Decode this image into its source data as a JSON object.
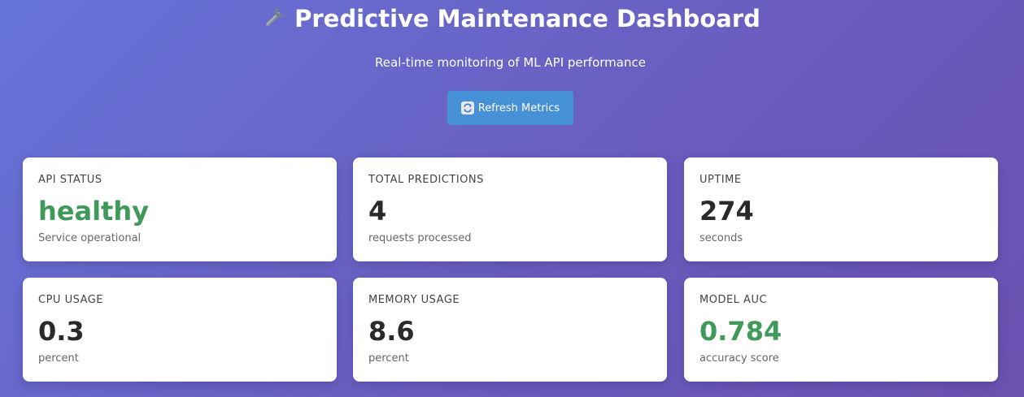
{
  "header": {
    "title": "Predictive Maintenance Dashboard",
    "title_icon": "wrench-icon",
    "subtitle": "Real-time monitoring of ML API performance"
  },
  "toolbar": {
    "refresh_label": "Refresh Metrics",
    "refresh_icon": "refresh-icon"
  },
  "colors": {
    "accent_button": "#4690d8",
    "good": "#3f9a5a",
    "value_default": "#2a2a2a"
  },
  "metrics": [
    {
      "label": "API STATUS",
      "value": "healthy",
      "sub": "Service operational",
      "status": "good"
    },
    {
      "label": "TOTAL PREDICTIONS",
      "value": "4",
      "sub": "requests processed",
      "status": "default"
    },
    {
      "label": "UPTIME",
      "value": "274",
      "sub": "seconds",
      "status": "default"
    },
    {
      "label": "CPU USAGE",
      "value": "0.3",
      "sub": "percent",
      "status": "default"
    },
    {
      "label": "MEMORY USAGE",
      "value": "8.6",
      "sub": "percent",
      "status": "default"
    },
    {
      "label": "MODEL AUC",
      "value": "0.784",
      "sub": "accuracy score",
      "status": "good"
    }
  ]
}
